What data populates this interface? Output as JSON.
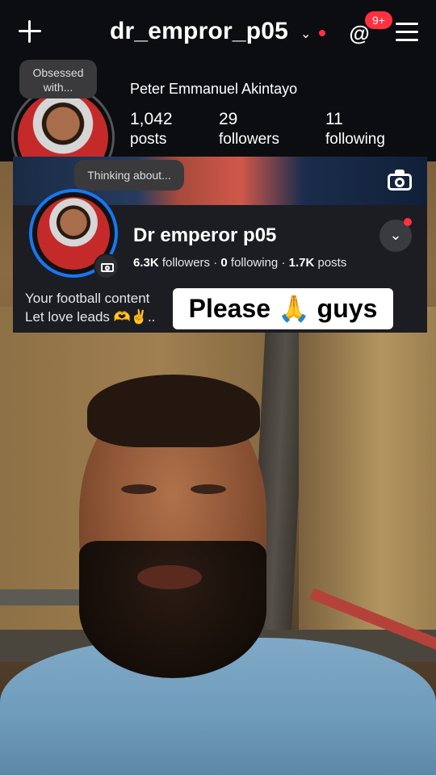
{
  "header": {
    "username": "dr_empror_p05",
    "notification_badge": "9+",
    "icons": [
      "plus-icon",
      "chevron-down-icon",
      "threads-icon",
      "menu-icon"
    ]
  },
  "profile": {
    "note": "Obsessed with...",
    "full_name": "Peter Emmanuel Akintayo",
    "stats": [
      {
        "value": "1,042",
        "label": "posts"
      },
      {
        "value": "29",
        "label": "followers"
      },
      {
        "value": "11",
        "label": "following"
      }
    ]
  },
  "page_card": {
    "note": "Thinking about...",
    "name": "Dr emperor p05",
    "followers": "6.3K",
    "followers_label": "followers",
    "following": "0",
    "following_label": "following",
    "posts": "1.7K",
    "posts_label": "posts",
    "separator": "·",
    "bio_line1": "Your football content",
    "bio_line2": "Let love leads 🫶✌️..",
    "accent": "#1877f2"
  },
  "caption": "Please 🙏 guys",
  "colors": {
    "badge": "#ff3040",
    "topbar_bg": "#0b0d10",
    "card_bg": "#1c1d22"
  }
}
